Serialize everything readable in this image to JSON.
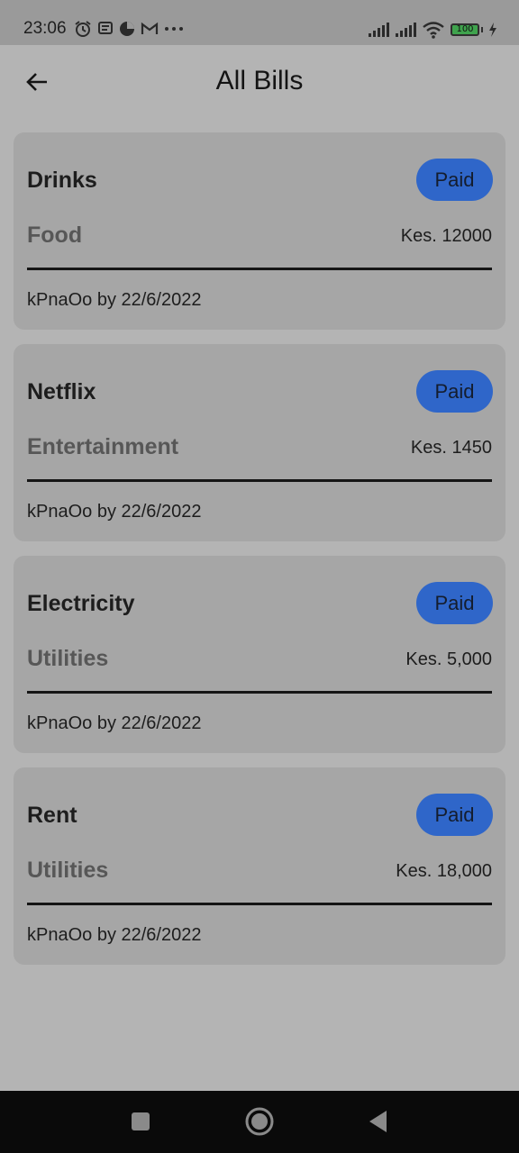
{
  "status_bar": {
    "time": "23:06",
    "battery_level": "100",
    "icons_left": [
      "alarm-icon",
      "message-icon",
      "app-notification-icon",
      "gmail-icon",
      "more-dots-icon"
    ],
    "icons_right": [
      "signal-icon",
      "signal-icon",
      "wifi-icon",
      "battery-icon",
      "charging-icon"
    ]
  },
  "app_bar": {
    "title": "All Bills",
    "back_icon": "arrow-left-icon"
  },
  "bills": [
    {
      "name": "Drinks",
      "status": "Paid",
      "category": "Food",
      "amount": "Kes. 12000",
      "meta": "kPnaOo by 22/6/2022"
    },
    {
      "name": "Netflix",
      "status": "Paid",
      "category": "Entertainment",
      "amount": "Kes. 1450",
      "meta": "kPnaOo by 22/6/2022"
    },
    {
      "name": "Electricity",
      "status": "Paid",
      "category": "Utilities",
      "amount": "Kes. 5,000",
      "meta": "kPnaOo by 22/6/2022"
    },
    {
      "name": "Rent",
      "status": "Paid",
      "category": "Utilities",
      "amount": "Kes. 18,000",
      "meta": "kPnaOo by 22/6/2022"
    }
  ],
  "nav_bar": {
    "icons": [
      "recents-square-icon",
      "home-circle-icon",
      "back-triangle-icon"
    ]
  },
  "colors": {
    "background": "#b4b4b4",
    "card": "#a6a6a6",
    "status_pill": "#2f66c9",
    "status_bar": "#9a9a9a",
    "nav_bar": "#0a0a0a",
    "battery_fill": "#3fa34d"
  }
}
